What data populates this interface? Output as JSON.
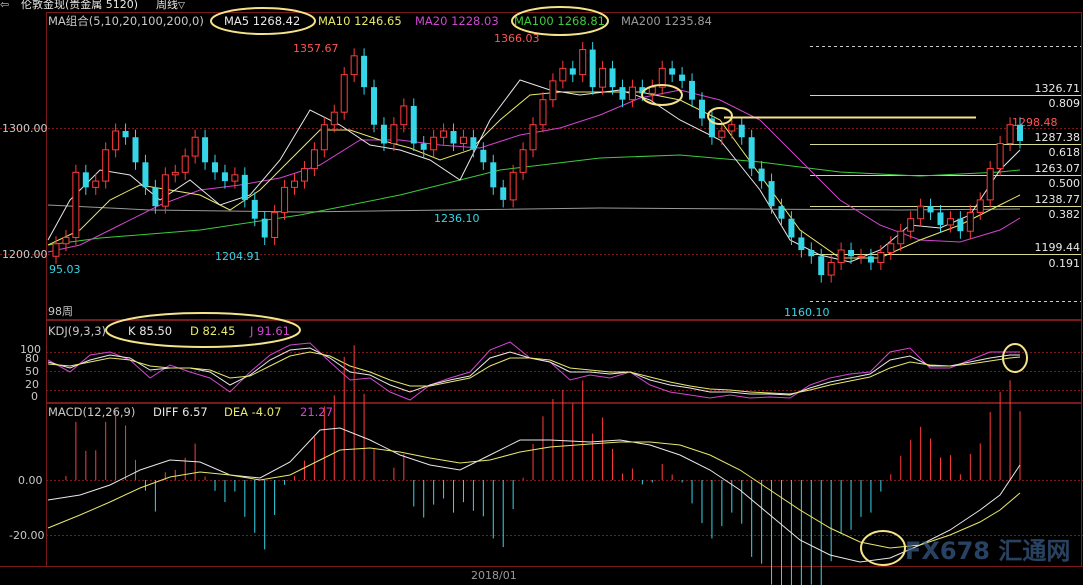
{
  "window": {
    "instrument": "伦敦金现(贵金属 5120)",
    "period": "周线",
    "period_dropdown_icon": "chevron-down-icon"
  },
  "colors": {
    "up": "#ff3b3b",
    "down": "#35d6e8",
    "ma5": "#e8e8e8",
    "ma10": "#e8e86a",
    "ma20": "#d046d0",
    "ma100": "#3ccc3c",
    "ma200": "#9a9a9a",
    "fib": "#d8d890",
    "highlight": "#f5e38a",
    "k_line": "#e8e8e8",
    "d_line": "#e8e86a",
    "j_line": "#d046d0",
    "diff_line": "#e8e8e8",
    "dea_line": "#e8e86a"
  },
  "main_legend": {
    "label": "MA组合(5,10,20,100,200,0)",
    "ma5": "MA5 1268.42",
    "ma10": "MA10 1246.65",
    "ma20": "MA20 1228.03",
    "ma100": "MA100 1268.81",
    "ma200": "MA200 1235.84"
  },
  "kdj_legend": {
    "label": "KDJ(9,3,3)",
    "k": "K 85.50",
    "d": "D 82.45",
    "j": "J 91.61"
  },
  "macd_legend": {
    "label": "MACD(12,26,9)",
    "diff": "DIFF 6.57",
    "dea": "DEA -4.07",
    "macd": "21.27"
  },
  "axes": {
    "price_ticks": [
      "1300.00",
      "1200.00"
    ],
    "kdj_ticks": [
      "100",
      "80",
      "50",
      "20",
      "0"
    ],
    "macd_ticks": [
      "0.00",
      "-20.00"
    ],
    "x_date": "2018/01",
    "period_count": "98周"
  },
  "annotations": {
    "high_1": "1357.67",
    "high_2": "1366.03",
    "low_1": "95.03",
    "low_2": "1204.91",
    "low_3": "1236.10",
    "low_4": "1160.10",
    "fib_values": [
      "1326.71",
      "1298.48",
      "1287.38",
      "1263.07",
      "1238.77",
      "1199.44"
    ],
    "fib_ratios": [
      "0.809",
      "0.618",
      "0.500",
      "0.382",
      "0.191"
    ],
    "resistance": "1298.48"
  },
  "watermark": "FX678 汇通网",
  "chart_data": {
    "type": "candlestick",
    "price_range": [
      1160.1,
      1366.03
    ],
    "closes_weekly": [
      1205,
      1210,
      1262,
      1250,
      1255,
      1280,
      1295,
      1290,
      1270,
      1250,
      1235,
      1260,
      1262,
      1275,
      1290,
      1270,
      1262,
      1255,
      1260,
      1240,
      1225,
      1210,
      1230,
      1250,
      1255,
      1265,
      1280,
      1300,
      1310,
      1340,
      1355,
      1330,
      1300,
      1285,
      1300,
      1315,
      1285,
      1280,
      1290,
      1295,
      1285,
      1290,
      1280,
      1270,
      1250,
      1240,
      1262,
      1280,
      1300,
      1320,
      1335,
      1345,
      1340,
      1360,
      1330,
      1345,
      1330,
      1320,
      1330,
      1325,
      1330,
      1345,
      1340,
      1335,
      1320,
      1305,
      1290,
      1295,
      1300,
      1290,
      1265,
      1255,
      1235,
      1225,
      1210,
      1200,
      1195,
      1180,
      1190,
      1200,
      1195,
      1195,
      1190,
      1198,
      1205,
      1215,
      1225,
      1235,
      1230,
      1220,
      1225,
      1215,
      1230,
      1240,
      1265,
      1285,
      1300,
      1287
    ]
  }
}
